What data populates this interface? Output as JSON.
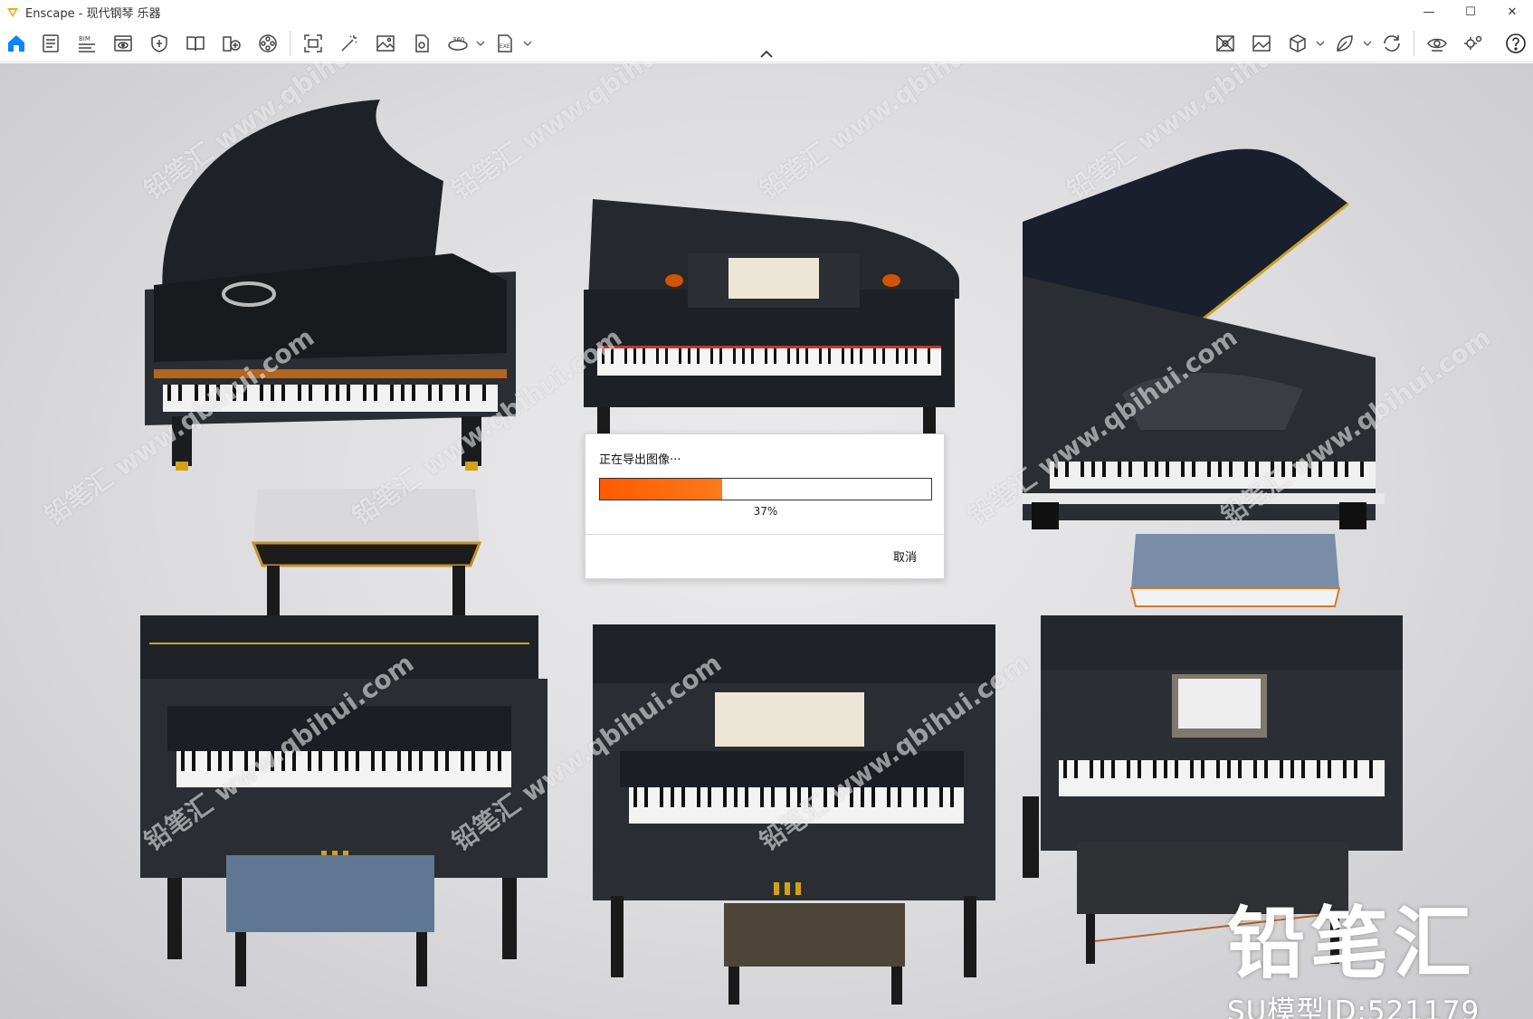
{
  "window": {
    "title": "Enscape - 现代钢琴 乐器",
    "minimize_glyph": "—",
    "maximize_glyph": "☐",
    "close_glyph": "✕"
  },
  "toolbar": {
    "left_icons": [
      "home-icon",
      "document-icon",
      "bim-icon",
      "view-icon",
      "shield-icon",
      "book-icon",
      "render-book-icon",
      "film-reel-icon",
      "screenshot-icon",
      "magic-wand-icon",
      "image-icon",
      "export-file-icon",
      "panorama-360-icon",
      "exe-export-icon"
    ],
    "right_icons": [
      "material-icon",
      "gallery-icon",
      "cube-icon",
      "leaf-icon",
      "sync-icon",
      "visibility-icon",
      "settings-icon",
      "help-icon"
    ],
    "accent_color": "#0a84ff"
  },
  "export_dialog": {
    "title": "正在导出图像···",
    "progress": 0.37,
    "progress_label": "37%",
    "cancel_label": "取消",
    "fill_color": "#ff6a00"
  },
  "watermark": {
    "brand": "铅笔汇",
    "model_id": "SU模型ID:521179",
    "repeated_text": "铅笔汇 www.qbihui.com"
  }
}
